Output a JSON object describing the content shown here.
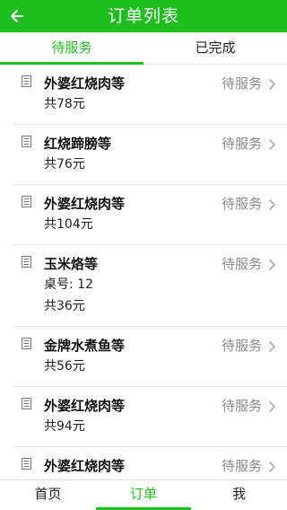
{
  "header": {
    "title": "订单列表",
    "back_icon": "arrow-left-icon",
    "background": "#1fbe1f"
  },
  "tabs": [
    {
      "label": "待服务",
      "active": true
    },
    {
      "label": "已完成",
      "active": false
    }
  ],
  "orders": [
    {
      "title": "外婆红烧肉等",
      "status": "待服务",
      "lines": [
        "共78元"
      ]
    },
    {
      "title": "红烧蹄膀等",
      "status": "待服务",
      "lines": [
        "共76元"
      ]
    },
    {
      "title": "外婆红烧肉等",
      "status": "待服务",
      "lines": [
        "共104元"
      ]
    },
    {
      "title": "玉米烙等",
      "status": "待服务",
      "lines": [
        "桌号: 12",
        "共36元"
      ]
    },
    {
      "title": "金牌水煮鱼等",
      "status": "待服务",
      "lines": [
        "共56元"
      ]
    },
    {
      "title": "外婆红烧肉等",
      "status": "待服务",
      "lines": [
        "共94元"
      ]
    },
    {
      "title": "外婆红烧肉等",
      "status": "待服务",
      "lines": []
    }
  ],
  "bottom_nav": [
    {
      "label": "首页",
      "active": false
    },
    {
      "label": "订单",
      "active": true
    },
    {
      "label": "我",
      "active": false
    }
  ],
  "colors": {
    "accent": "#1fbe1f",
    "status_text": "#8a8a8a"
  }
}
